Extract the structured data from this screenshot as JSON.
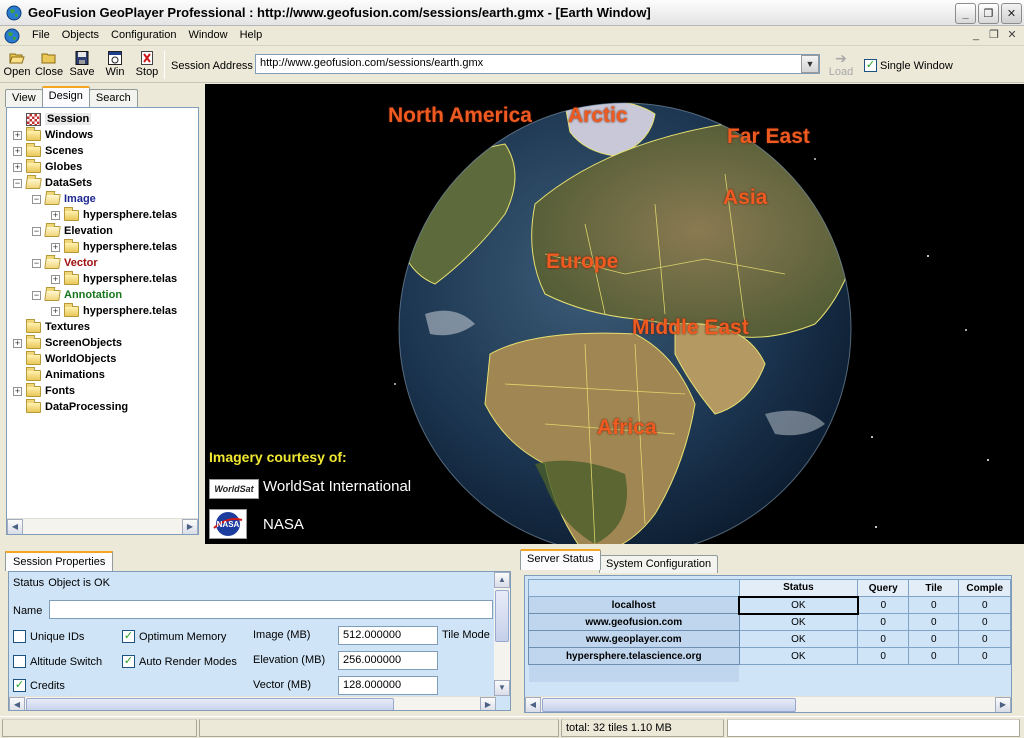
{
  "window": {
    "title": "GeoFusion GeoPlayer Professional : http://www.geofusion.com/sessions/earth.gmx - [Earth Window]",
    "buttons": [
      "_",
      "❐",
      "✕"
    ]
  },
  "menubar": {
    "items": [
      "File",
      "Objects",
      "Configuration",
      "Window",
      "Help"
    ],
    "mdi_buttons": [
      "_",
      "❐",
      "✕"
    ]
  },
  "toolbar": {
    "buttons": [
      {
        "label": "Open",
        "icon": "open-folder-icon"
      },
      {
        "label": "Close",
        "icon": "close-folder-icon"
      },
      {
        "label": "Save",
        "icon": "floppy-disk-icon"
      },
      {
        "label": "Win",
        "icon": "window-icon"
      },
      {
        "label": "Stop",
        "icon": "stop-icon"
      }
    ],
    "address_label": "Session Address",
    "address_value": "http://www.geofusion.com/sessions/earth.gmx",
    "load_label": "Load",
    "single_window_label": "Single Window",
    "single_window_checked": true
  },
  "left_panel": {
    "tabs": [
      "View",
      "Design",
      "Search"
    ],
    "active_tab": "Design",
    "tree": [
      {
        "label": "Session",
        "depth": 0,
        "expander": "",
        "icon": "session-icon",
        "selected": true
      },
      {
        "label": "Windows",
        "depth": 0,
        "expander": "+",
        "icon": "folder-icon"
      },
      {
        "label": "Scenes",
        "depth": 0,
        "expander": "+",
        "icon": "folder-icon"
      },
      {
        "label": "Globes",
        "depth": 0,
        "expander": "+",
        "icon": "folder-icon"
      },
      {
        "label": "DataSets",
        "depth": 0,
        "expander": "−",
        "icon": "open-folder-icon"
      },
      {
        "label": "Image",
        "depth": 1,
        "expander": "−",
        "icon": "open-folder-icon",
        "color": "blue"
      },
      {
        "label": "hypersphere.telas",
        "depth": 2,
        "expander": "+",
        "icon": "folder-icon"
      },
      {
        "label": "Elevation",
        "depth": 1,
        "expander": "−",
        "icon": "open-folder-icon"
      },
      {
        "label": "hypersphere.telas",
        "depth": 2,
        "expander": "+",
        "icon": "folder-icon"
      },
      {
        "label": "Vector",
        "depth": 1,
        "expander": "−",
        "icon": "open-folder-icon",
        "color": "red"
      },
      {
        "label": "hypersphere.telas",
        "depth": 2,
        "expander": "+",
        "icon": "folder-icon"
      },
      {
        "label": "Annotation",
        "depth": 1,
        "expander": "−",
        "icon": "open-folder-icon",
        "color": "green"
      },
      {
        "label": "hypersphere.telas",
        "depth": 2,
        "expander": "+",
        "icon": "folder-icon"
      },
      {
        "label": "Textures",
        "depth": 0,
        "expander": "",
        "icon": "folder-icon"
      },
      {
        "label": "ScreenObjects",
        "depth": 0,
        "expander": "+",
        "icon": "folder-icon"
      },
      {
        "label": "WorldObjects",
        "depth": 0,
        "expander": "",
        "icon": "folder-icon"
      },
      {
        "label": "Animations",
        "depth": 0,
        "expander": "",
        "icon": "folder-icon"
      },
      {
        "label": "Fonts",
        "depth": 0,
        "expander": "+",
        "icon": "folder-icon"
      },
      {
        "label": "DataProcessing",
        "depth": 0,
        "expander": "",
        "icon": "folder-icon"
      }
    ]
  },
  "globe": {
    "labels": [
      "North America",
      "Arctic",
      "Far East",
      "Asia",
      "Europe",
      "Middle East",
      "Africa"
    ],
    "imagery_title": "Imagery courtesy of:",
    "credits": [
      {
        "logo_text": "WorldSat",
        "name": "WorldSat International"
      },
      {
        "logo_text": "NASA",
        "name": "NASA"
      }
    ],
    "colors": {
      "label": "#ef5a20",
      "imagery_title": "#f0e832",
      "borders": "#e8e070"
    }
  },
  "session_properties": {
    "tab": "Session Properties",
    "status_label": "Status",
    "status_value": "Object is OK",
    "name_label": "Name",
    "name_value": "",
    "checkboxes": [
      {
        "label": "Unique IDs",
        "checked": false
      },
      {
        "label": "Optimum Memory",
        "checked": true
      },
      {
        "label": "Altitude Switch",
        "checked": false
      },
      {
        "label": "Auto Render Modes",
        "checked": true
      },
      {
        "label": "Credits",
        "checked": true
      }
    ],
    "fields": [
      {
        "label": "Image (MB)",
        "value": "512.000000"
      },
      {
        "label": "Elevation (MB)",
        "value": "256.000000"
      },
      {
        "label": "Vector (MB)",
        "value": "128.000000"
      }
    ],
    "tile_mode_label": "Tile Mode"
  },
  "server_status": {
    "tabs": [
      "Server Status",
      "System Configuration"
    ],
    "active_tab": "Server Status",
    "columns": [
      "",
      "Status",
      "Query",
      "Tile",
      "Comple"
    ],
    "rows": [
      {
        "host": "localhost",
        "status": "OK",
        "query": "0",
        "tile": "0",
        "complete": "0"
      },
      {
        "host": "www.geofusion.com",
        "status": "OK",
        "query": "0",
        "tile": "0",
        "complete": "0"
      },
      {
        "host": "www.geoplayer.com",
        "status": "OK",
        "query": "0",
        "tile": "0",
        "complete": "0"
      },
      {
        "host": "hypersphere.telascience.org",
        "status": "OK",
        "query": "0",
        "tile": "0",
        "complete": "0"
      }
    ]
  },
  "statusbar": {
    "total": "total: 32 tiles 1.10 MB"
  }
}
